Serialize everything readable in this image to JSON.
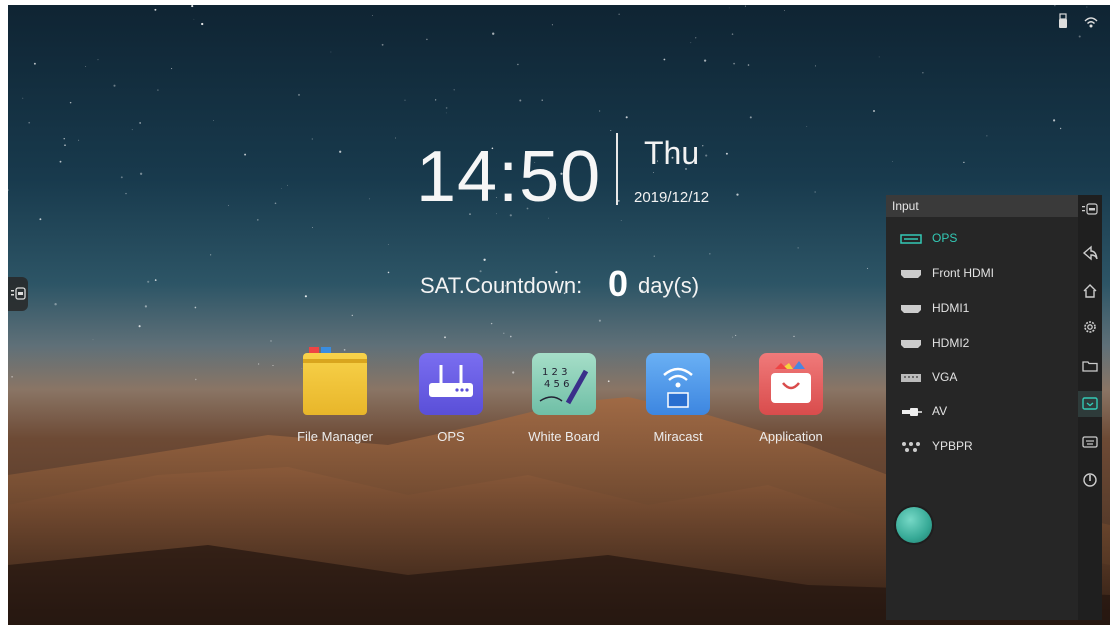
{
  "home": {
    "time": "14:50",
    "day": "Thu",
    "date": "2019/12/12",
    "countdown_label": "SAT.Countdown:",
    "countdown_value": "0",
    "countdown_unit": "day(s)"
  },
  "apps": [
    {
      "label": "File Manager",
      "icon": "folder-icon"
    },
    {
      "label": "OPS",
      "icon": "router-icon"
    },
    {
      "label": "White Board",
      "icon": "whiteboard-icon"
    },
    {
      "label": "Miracast",
      "icon": "miracast-icon"
    },
    {
      "label": "Application",
      "icon": "toolbox-icon"
    }
  ],
  "input_panel": {
    "title": "Input",
    "items": [
      {
        "label": "OPS",
        "icon": "ops-port-icon",
        "active": true
      },
      {
        "label": "Front HDMI",
        "icon": "hdmi-port-icon",
        "active": false
      },
      {
        "label": "HDMI1",
        "icon": "hdmi-port-icon",
        "active": false
      },
      {
        "label": "HDMI2",
        "icon": "hdmi-port-icon",
        "active": false
      },
      {
        "label": "VGA",
        "icon": "vga-port-icon",
        "active": false
      },
      {
        "label": "AV",
        "icon": "av-port-icon",
        "active": false
      },
      {
        "label": "YPBPR",
        "icon": "ypbpr-port-icon",
        "active": false
      }
    ]
  },
  "sidebar": {
    "buttons": [
      "menu-toggle-icon",
      "back-icon",
      "home-icon",
      "settings-icon",
      "folder-icon",
      "input-source-icon",
      "keyboard-icon",
      "power-icon"
    ],
    "active": "input-source-icon"
  },
  "status_icons": [
    "usb-icon",
    "network-icon"
  ],
  "colors": {
    "accent": "#33c9b5",
    "panel_bg": "#262626"
  }
}
